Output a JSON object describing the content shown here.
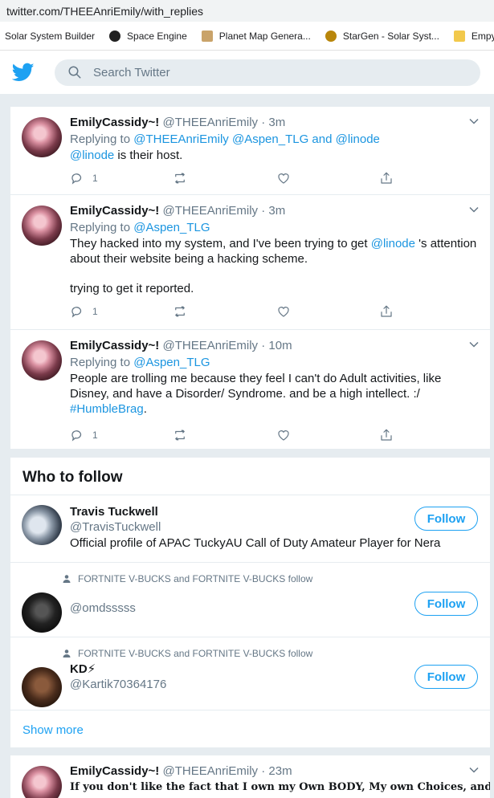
{
  "browser": {
    "url": "twitter.com/THEEAnriEmily/with_replies",
    "bookmarks": [
      {
        "label": "Solar System Builder",
        "icon": "none",
        "color": ""
      },
      {
        "label": "Space Engine",
        "icon": "space-engine-icon",
        "color": "#222222"
      },
      {
        "label": "Planet Map Genera...",
        "icon": "planet-map-icon",
        "color": "#c9a36a"
      },
      {
        "label": "StarGen - Solar Syst...",
        "icon": "stargen-icon",
        "color": "#b8860b"
      },
      {
        "label": "Empyric",
        "icon": "bookmark-folder-icon",
        "color": "#f2c94c"
      }
    ]
  },
  "header": {
    "search_placeholder": "Search Twitter",
    "accent": "#1da1f2"
  },
  "tweets": [
    {
      "name": "EmilyCassidy~!",
      "handle": "@THEEAnriEmily",
      "sep": "·",
      "time": "3m",
      "replying_prefix": "Replying to",
      "replying_to": [
        "@THEEAnriEmily",
        "@Aspen_TLG"
      ],
      "replying_and": "and",
      "replying_last": "@linode",
      "text_link": "@linode",
      "text": " is their host.",
      "reply_count": "1"
    },
    {
      "name": "EmilyCassidy~!",
      "handle": "@THEEAnriEmily",
      "sep": "·",
      "time": "3m",
      "replying_prefix": "Replying to",
      "replying_to": "@Aspen_TLG",
      "text_a": "They hacked into my system, and I've been trying to get",
      "text_link": "@linode",
      "text_b": "'s attention about their website being a hacking scheme.",
      "text_c": "trying to get it reported.",
      "reply_count": "1"
    },
    {
      "name": "EmilyCassidy~!",
      "handle": "@THEEAnriEmily",
      "sep": "·",
      "time": "10m",
      "replying_prefix": "Replying to",
      "replying_to": "@Aspen_TLG",
      "text": "People are trolling me because they feel I can't do Adult activities, like Disney, and have a Disorder/ Syndrome.  and be a high intellect. :/",
      "hashtag": "#HumbleBrag",
      "hashtag_after": ".",
      "reply_count": "1"
    },
    {
      "name": "EmilyCassidy~!",
      "handle": "@THEEAnriEmily",
      "sep": "·",
      "time": "23m",
      "text": "If you don't like the fact that I own my Own BODY, My own Choices, and"
    }
  ],
  "who_to_follow": {
    "title": "Who to follow",
    "follow_label": "Follow",
    "show_more": "Show more",
    "items": [
      {
        "name": "Travis Tuckwell",
        "handle": "@TravisTuckwell",
        "bio": "Official profile of APAC TuckyAU Call of Duty Amateur Player for Nera"
      },
      {
        "context": "FORTNITE V-BUCKS and FORTNITE V-BUCKS follow",
        "handle": "@omdsssss"
      },
      {
        "context": "FORTNITE V-BUCKS and FORTNITE V-BUCKS follow",
        "name": "KD⚡",
        "handle": "@Kartik70364176"
      }
    ]
  }
}
